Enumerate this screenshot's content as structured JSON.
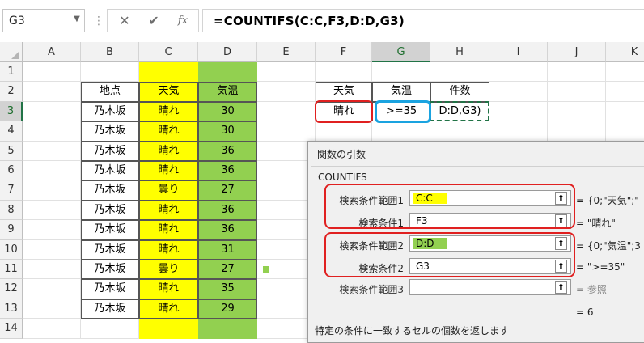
{
  "name_box": "G3",
  "formula_bar": {
    "cancel_glyph": "✕",
    "enter_glyph": "✔",
    "fx_glyph": "fx",
    "formula": "=COUNTIFS(C:C,F3,D:D,G3)"
  },
  "columns": [
    "A",
    "B",
    "C",
    "D",
    "E",
    "F",
    "G",
    "H",
    "I",
    "J",
    "K"
  ],
  "rows": [
    "1",
    "2",
    "3",
    "4",
    "5",
    "6",
    "7",
    "8",
    "9",
    "10",
    "11",
    "12",
    "13",
    "14"
  ],
  "table": {
    "headers": [
      "地点",
      "天気",
      "気温"
    ],
    "rows": [
      [
        "乃木坂",
        "晴れ",
        "30"
      ],
      [
        "乃木坂",
        "晴れ",
        "30"
      ],
      [
        "乃木坂",
        "晴れ",
        "36"
      ],
      [
        "乃木坂",
        "晴れ",
        "36"
      ],
      [
        "乃木坂",
        "曇り",
        "27"
      ],
      [
        "乃木坂",
        "晴れ",
        "36"
      ],
      [
        "乃木坂",
        "晴れ",
        "36"
      ],
      [
        "乃木坂",
        "晴れ",
        "31"
      ],
      [
        "乃木坂",
        "曇り",
        "27"
      ],
      [
        "乃木坂",
        "晴れ",
        "35"
      ],
      [
        "乃木坂",
        "晴れ",
        "29"
      ]
    ]
  },
  "criteria_table": {
    "headers": [
      "天気",
      "気温",
      "件数"
    ],
    "values": [
      "晴れ",
      ">=35",
      "D:D,G3)"
    ]
  },
  "dialog": {
    "title": "関数の引数",
    "function_name": "COUNTIFS",
    "args": [
      {
        "label": "検索条件範囲1",
        "value": "C:C",
        "result": "= {0;\"天気\";\""
      },
      {
        "label": "検索条件1",
        "value": "F3",
        "result": "= \"晴れ\""
      },
      {
        "label": "検索条件範囲2",
        "value": "D:D",
        "result": "= {0;\"気温\";3"
      },
      {
        "label": "検索条件2",
        "value": "G3",
        "result": "= \">=35\""
      },
      {
        "label": "検索条件範囲3",
        "value": "",
        "result": "= 参照"
      }
    ],
    "total_result": "= 6",
    "description": "特定の条件に一致するセルの個数を返します",
    "collapse_glyph": "⬆"
  },
  "colors": {
    "yellow": "#ffff00",
    "green": "#92d050",
    "excel_green": "#217346",
    "red_highlight": "#e02020",
    "blue_highlight": "#1aa3e0"
  }
}
